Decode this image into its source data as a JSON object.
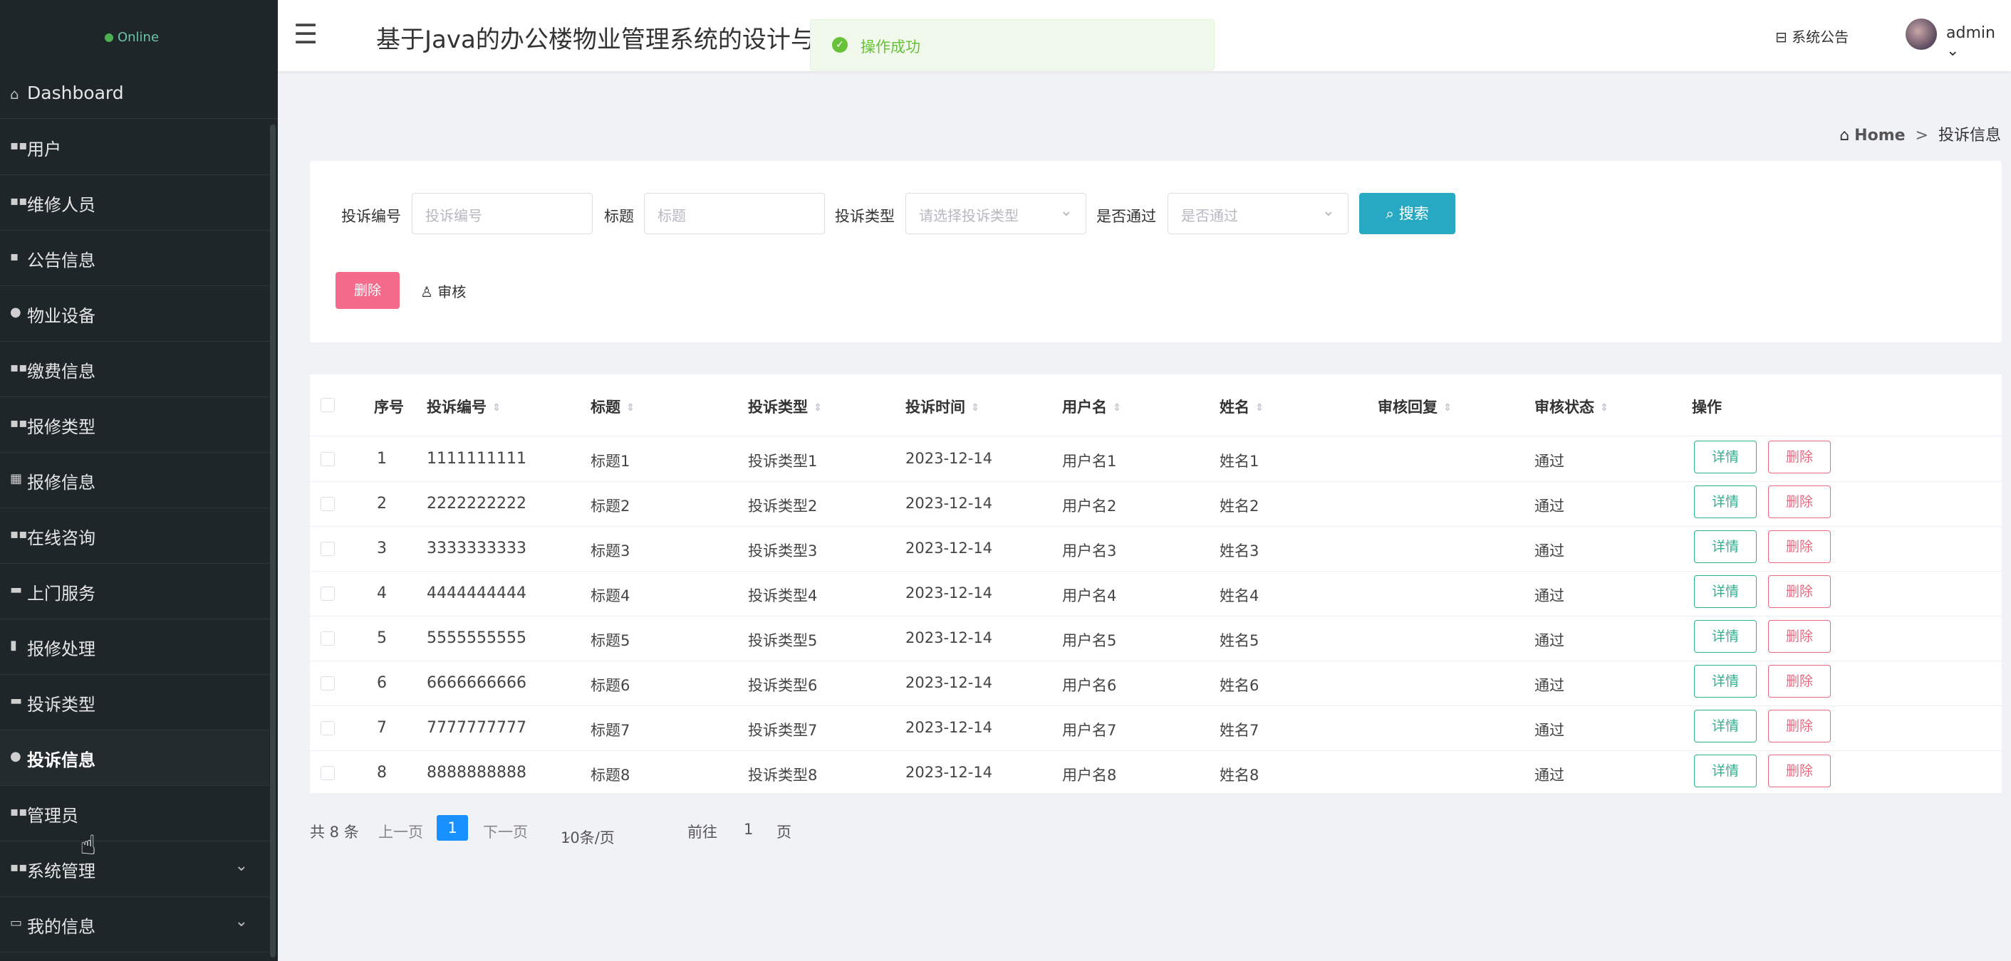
{
  "sidebar": {
    "status": "Online",
    "dashboard": "Dashboard",
    "items": [
      {
        "label": "用户",
        "icon": "grid-icon",
        "glyph": "▪▪"
      },
      {
        "label": "维修人员",
        "icon": "grid-icon",
        "glyph": "▪▪"
      },
      {
        "label": "公告信息",
        "icon": "book-icon",
        "glyph": "▪"
      },
      {
        "label": "物业设备",
        "icon": "user-icon",
        "glyph": "●"
      },
      {
        "label": "缴费信息",
        "icon": "grid-icon",
        "glyph": "▪▪"
      },
      {
        "label": "报修类型",
        "icon": "grid-icon",
        "glyph": "▪▪"
      },
      {
        "label": "报修信息",
        "icon": "table-icon",
        "glyph": "▦"
      },
      {
        "label": "在线咨询",
        "icon": "grid-icon",
        "glyph": "▪▪"
      },
      {
        "label": "上门服务",
        "icon": "briefcase-icon",
        "glyph": "▬"
      },
      {
        "label": "报修处理",
        "icon": "bar-chart-icon",
        "glyph": "▮"
      },
      {
        "label": "投诉类型",
        "icon": "folder-icon",
        "glyph": "▬"
      },
      {
        "label": "投诉信息",
        "icon": "user-icon",
        "glyph": "●"
      },
      {
        "label": "管理员",
        "icon": "grid-icon",
        "glyph": "▪▪"
      },
      {
        "label": "系统管理",
        "icon": "grid-icon",
        "glyph": "▪▪"
      },
      {
        "label": "我的信息",
        "icon": "id-card-icon",
        "glyph": "▭"
      }
    ]
  },
  "topbar": {
    "title": "基于Java的办公楼物业管理系统的设计与实现",
    "notice": "系统公告",
    "user": "admin"
  },
  "toast": {
    "message": "操作成功"
  },
  "breadcrumb": {
    "home": "Home",
    "sep": ">",
    "current": "投诉信息"
  },
  "search": {
    "fields": [
      {
        "label": "投诉编号",
        "placeholder": "投诉编号"
      },
      {
        "label": "标题",
        "placeholder": "标题"
      },
      {
        "label": "投诉类型",
        "placeholder": "请选择投诉类型"
      },
      {
        "label": "是否通过",
        "placeholder": "是否通过"
      }
    ],
    "search_label": "搜索",
    "delete_label": "删除",
    "audit_label": "审核"
  },
  "table": {
    "headers": [
      "序号",
      "投诉编号",
      "标题",
      "投诉类型",
      "投诉时间",
      "用户名",
      "姓名",
      "审核回复",
      "审核状态",
      "操作"
    ],
    "rows": [
      {
        "idx": "1",
        "code": "1111111111",
        "title": "标题1",
        "type": "投诉类型1",
        "time": "2023-12-14",
        "username": "用户名1",
        "name": "姓名1",
        "reply": "",
        "status": "通过"
      },
      {
        "idx": "2",
        "code": "2222222222",
        "title": "标题2",
        "type": "投诉类型2",
        "time": "2023-12-14",
        "username": "用户名2",
        "name": "姓名2",
        "reply": "",
        "status": "通过"
      },
      {
        "idx": "3",
        "code": "3333333333",
        "title": "标题3",
        "type": "投诉类型3",
        "time": "2023-12-14",
        "username": "用户名3",
        "name": "姓名3",
        "reply": "",
        "status": "通过"
      },
      {
        "idx": "4",
        "code": "4444444444",
        "title": "标题4",
        "type": "投诉类型4",
        "time": "2023-12-14",
        "username": "用户名4",
        "name": "姓名4",
        "reply": "",
        "status": "通过"
      },
      {
        "idx": "5",
        "code": "5555555555",
        "title": "标题5",
        "type": "投诉类型5",
        "time": "2023-12-14",
        "username": "用户名5",
        "name": "姓名5",
        "reply": "",
        "status": "通过"
      },
      {
        "idx": "6",
        "code": "6666666666",
        "title": "标题6",
        "type": "投诉类型6",
        "time": "2023-12-14",
        "username": "用户名6",
        "name": "姓名6",
        "reply": "",
        "status": "通过"
      },
      {
        "idx": "7",
        "code": "7777777777",
        "title": "标题7",
        "type": "投诉类型7",
        "time": "2023-12-14",
        "username": "用户名7",
        "name": "姓名7",
        "reply": "",
        "status": "通过"
      },
      {
        "idx": "8",
        "code": "8888888888",
        "title": "标题8",
        "type": "投诉类型8",
        "time": "2023-12-14",
        "username": "用户名8",
        "name": "姓名8",
        "reply": "",
        "status": "通过"
      }
    ],
    "detail_label": "详情",
    "delete_label": "删除"
  },
  "pagination": {
    "total": "共 8 条",
    "prev": "上一页",
    "current": "1",
    "next": "下一页",
    "page_size": "10条/页",
    "goto_prefix": "前往",
    "goto_value": "1",
    "goto_suffix": "页"
  },
  "colors": {
    "sidebar_bg": "#1f2629",
    "primary": "#27a9c4",
    "danger": "#f46b8b",
    "success": "#67c23a"
  }
}
